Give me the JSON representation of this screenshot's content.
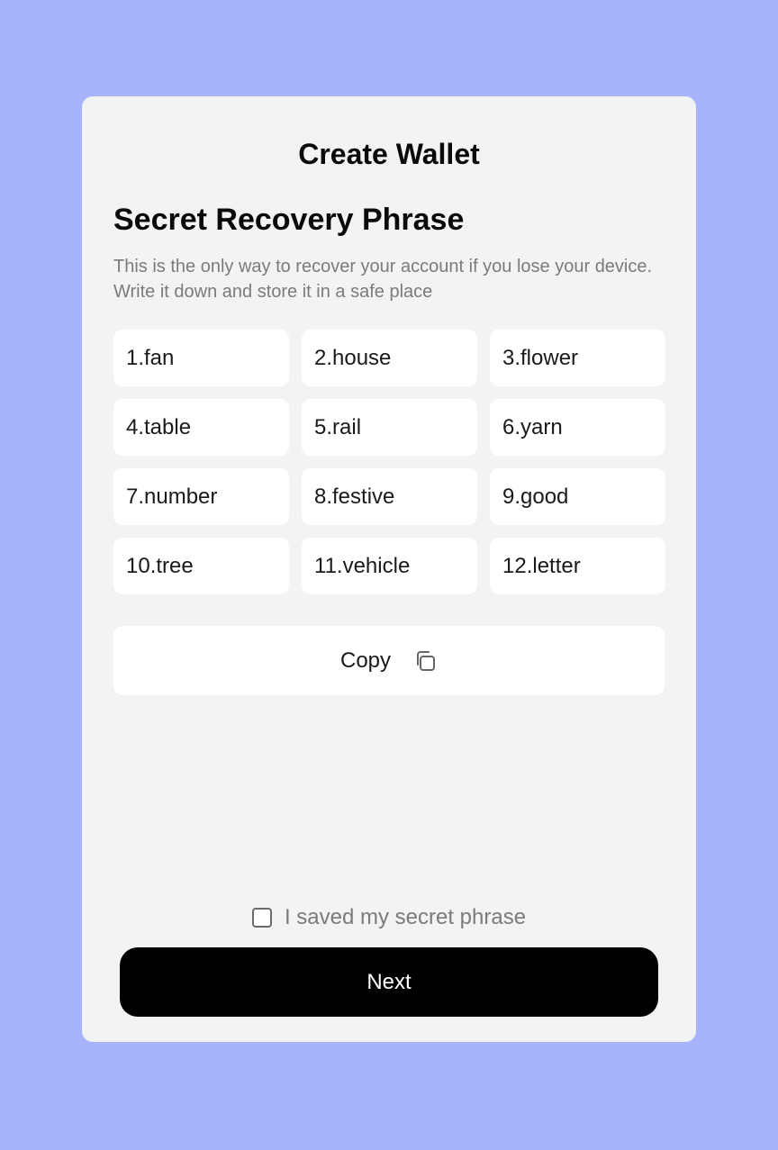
{
  "header": {
    "title": "Create Wallet"
  },
  "phrase": {
    "title": "Secret Recovery Phrase",
    "description": "This is the only way to recover your account if you lose your device. Write it down and store it in a safe place",
    "words": [
      "1.fan",
      "2.house",
      "3.flower",
      "4.table",
      "5.rail",
      "6.yarn",
      "7.number",
      "8.festive",
      "9.good",
      "10.tree",
      "11.vehicle",
      "12.letter"
    ]
  },
  "copy": {
    "label": "Copy",
    "icon": "copy-icon"
  },
  "confirm": {
    "label": "I saved my secret phrase",
    "checked": false
  },
  "next": {
    "label": "Next"
  },
  "colors": {
    "background": "#a6b3fd",
    "card": "#f3f3f3",
    "primary_button": "#000000"
  }
}
